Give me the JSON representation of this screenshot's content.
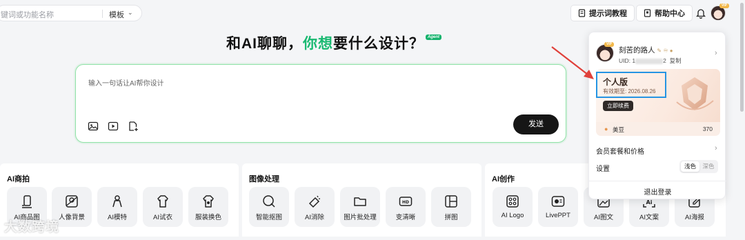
{
  "search": {
    "placeholder": "键词或功能名称",
    "scope": "模板"
  },
  "header": {
    "prompt_tutorial": "提示词教程",
    "help_center": "帮助中心",
    "vip_badge": "VIP"
  },
  "hero": {
    "title_a": "和AI聊聊，",
    "title_b": "你想",
    "title_c": "要什么设计？",
    "tag": "Agent"
  },
  "chat": {
    "placeholder": "输入一句话让AI帮你设计",
    "send": "发送"
  },
  "sections": [
    {
      "title": "AI商拍",
      "items": [
        {
          "label": "AI商品图",
          "icon": "product-photo-icon"
        },
        {
          "label": "人像背景",
          "icon": "portrait-background-icon"
        },
        {
          "label": "AI模特",
          "icon": "model-icon"
        },
        {
          "label": "AI试衣",
          "icon": "try-on-icon"
        },
        {
          "label": "服装换色",
          "icon": "clothes-recolor-icon"
        }
      ]
    },
    {
      "title": "图像处理",
      "items": [
        {
          "label": "智能抠图",
          "icon": "cutout-icon"
        },
        {
          "label": "AI消除",
          "icon": "eraser-icon"
        },
        {
          "label": "图片批处理",
          "icon": "folder-icon"
        },
        {
          "label": "变清晰",
          "icon": "hd-icon"
        },
        {
          "label": "拼图",
          "icon": "collage-icon"
        }
      ]
    },
    {
      "title": "AI创作",
      "items": [
        {
          "label": "AI Logo",
          "icon": "logo-icon"
        },
        {
          "label": "LivePPT",
          "icon": "ppt-icon"
        },
        {
          "label": "AI图文",
          "icon": "image-text-icon"
        },
        {
          "label": "AI文案",
          "icon": "copywriting-icon"
        },
        {
          "label": "AI海报",
          "icon": "poster-icon"
        }
      ]
    }
  ],
  "panel": {
    "username": "刻苦的路人",
    "uid_prefix": "UID: 1",
    "uid_suffix": "2",
    "copy": "复制",
    "plan": "个人版",
    "expiry": "有效期至: 2026.08.26",
    "renew": "立即续费",
    "beans_label": "美豆",
    "beans_value": "370",
    "membership": "会员套餐和价格",
    "settings": "设置",
    "theme_light": "浅色",
    "theme_dark": "深色",
    "logout": "退出登录"
  },
  "watermark": "大数跨境",
  "colors": {
    "accent_green": "#19b971",
    "highlight_blue": "#2494e3",
    "annotation_red": "#e0403a"
  }
}
